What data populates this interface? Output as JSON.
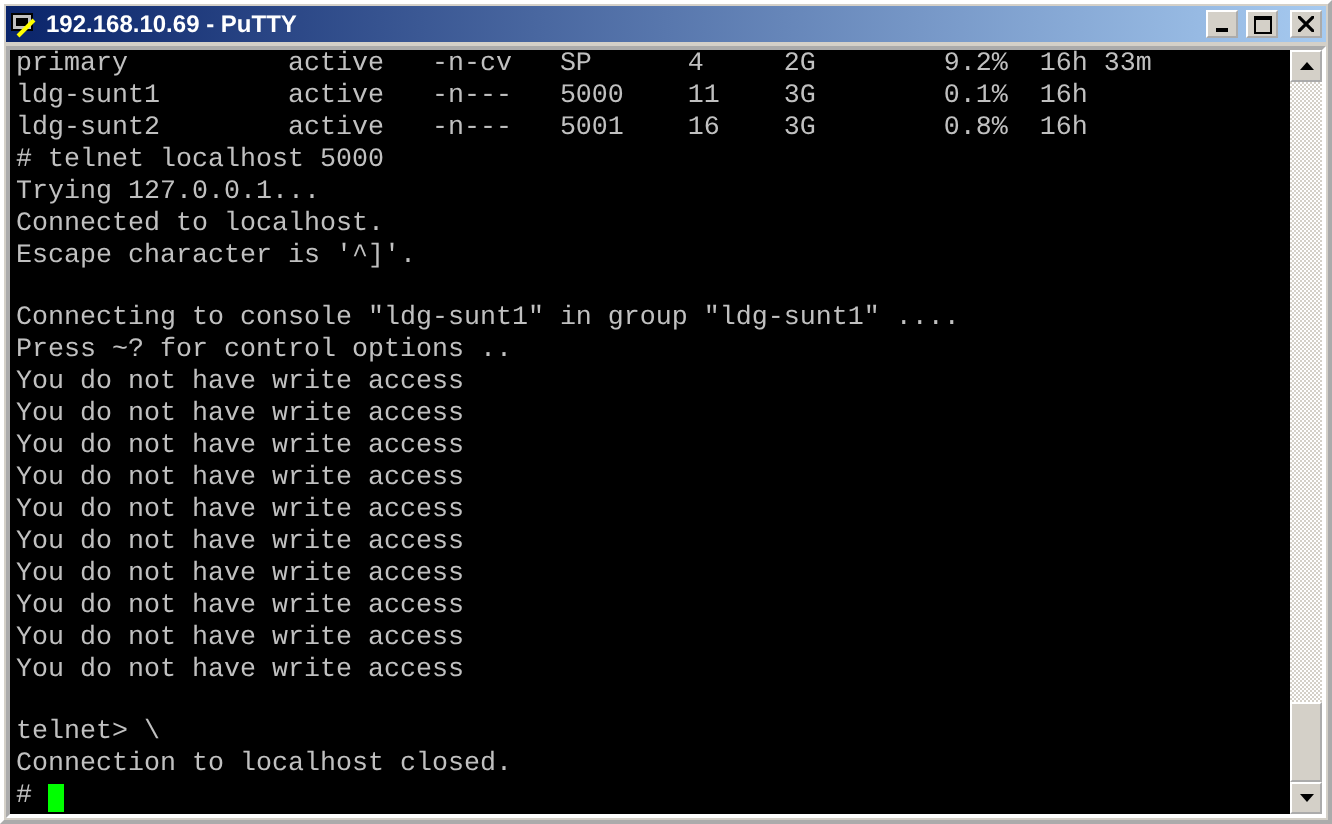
{
  "window": {
    "title": "192.168.10.69 - PuTTY"
  },
  "terminal": {
    "blocks": [
      [
        "primary          active   -n-cv   SP      4     2G        9.2%  16h 33m",
        "ldg-sunt1        active   -n---   5000    11    3G        0.1%  16h",
        "ldg-sunt2        active   -n---   5001    16    3G        0.8%  16h",
        "# telnet localhost 5000",
        "Trying 127.0.0.1...",
        "Connected to localhost.",
        "Escape character is '^]'."
      ],
      [
        "Connecting to console \"ldg-sunt1\" in group \"ldg-sunt1\" ....",
        "Press ~? for control options ..",
        "You do not have write access",
        "You do not have write access",
        "You do not have write access",
        "You do not have write access",
        "You do not have write access",
        "You do not have write access",
        "You do not have write access",
        "You do not have write access",
        "You do not have write access",
        "You do not have write access"
      ],
      [
        "telnet> \\",
        "Connection to localhost closed."
      ]
    ],
    "prompt": "#"
  }
}
